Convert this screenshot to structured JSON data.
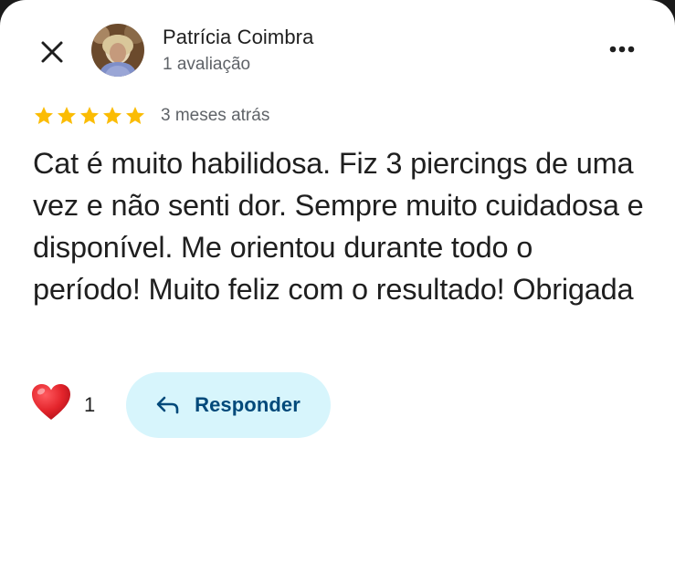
{
  "author": {
    "name": "Patrícia Coimbra",
    "meta": "1 avaliação"
  },
  "review": {
    "rating": 5,
    "rating_max": 5,
    "time": "3 meses atrás",
    "text": "Cat é muito habilidosa. Fiz 3 piercings de uma vez e não senti dor. Sempre muito cuidadosa e disponível. Me orientou durante todo o período! Muito feliz com o resultado! Obrigada"
  },
  "reactions": {
    "heart_count": "1"
  },
  "actions": {
    "reply_label": "Responder"
  },
  "icons": {
    "close": "close-icon",
    "more": "more-vert-icon",
    "star": "star-icon",
    "heart": "heart-icon",
    "reply": "reply-arrow-icon"
  },
  "colors": {
    "star": "#fbbc04",
    "reply_bg": "#d7f5fc",
    "reply_text": "#00497a",
    "heart": "#e3242b",
    "secondary_text": "#5f6368"
  }
}
